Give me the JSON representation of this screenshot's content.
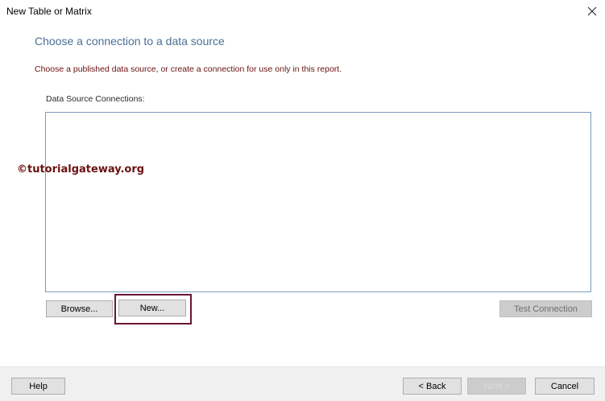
{
  "window": {
    "title": "New Table or Matrix"
  },
  "page": {
    "heading": "Choose a connection to a data source",
    "instruction": "Choose a published data source, or create a connection for use only in this report.",
    "list_label": "Data Source Connections:",
    "watermark": "©tutorialgateway.org"
  },
  "actions": {
    "browse_label": "Browse...",
    "new_label": "New...",
    "test_connection_label": "Test Connection"
  },
  "footer": {
    "help_label": "Help",
    "back_label": "< Back",
    "next_label": "Next >",
    "cancel_label": "Cancel"
  },
  "icons": {
    "close": "close-icon"
  },
  "colors": {
    "heading": "#4d6f95",
    "instruction": "#6b1111",
    "highlight": "#6b1535",
    "list_border": "#7a9bbd"
  }
}
